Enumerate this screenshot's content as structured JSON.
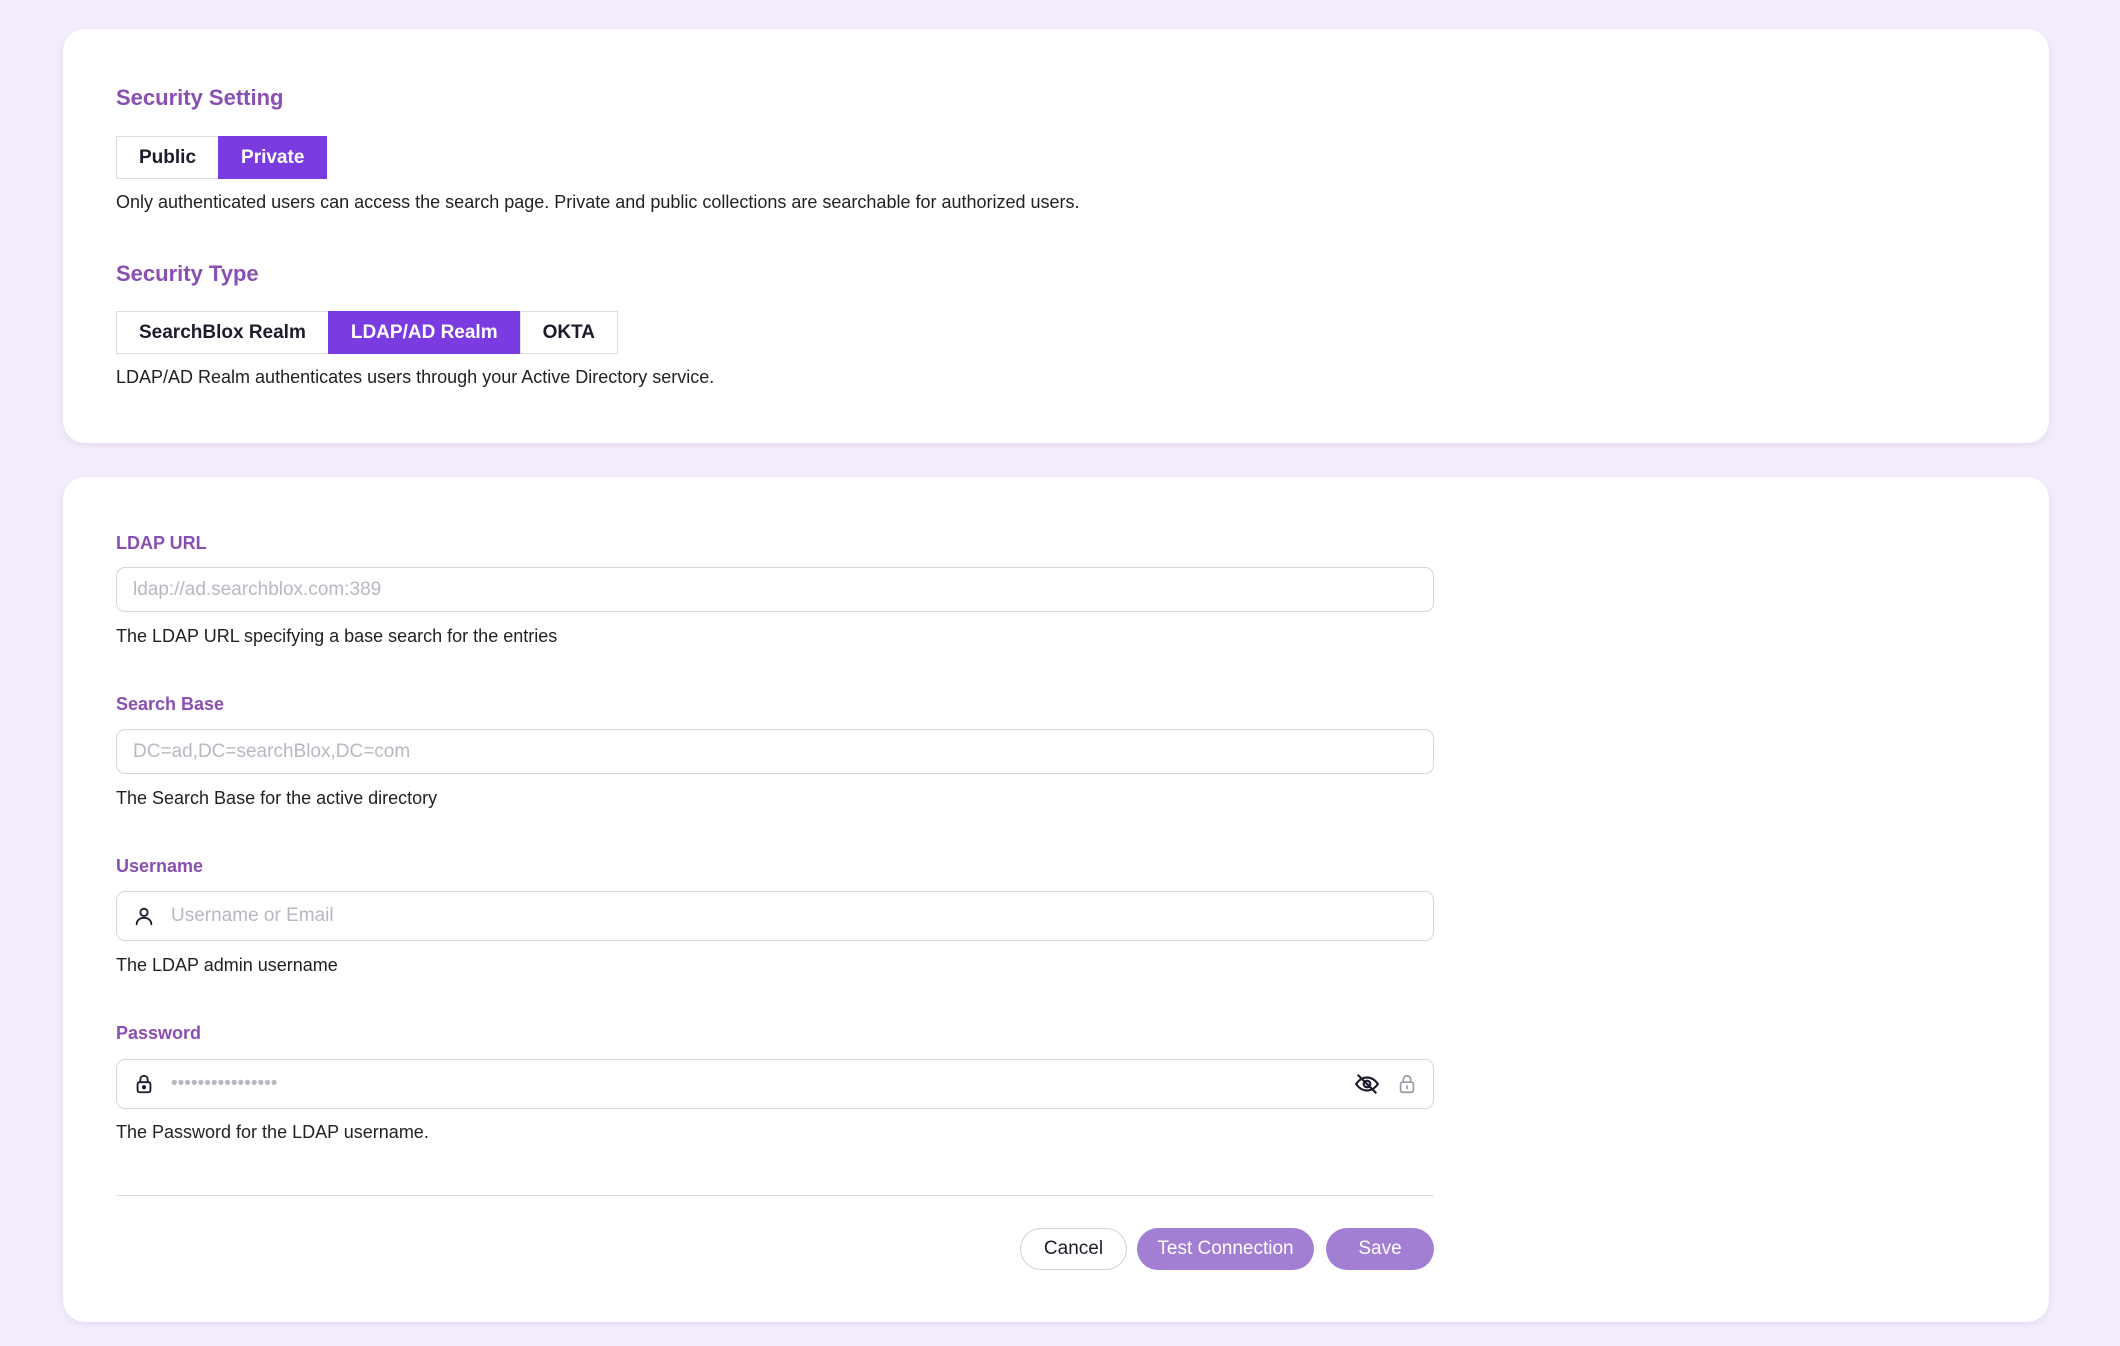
{
  "security_setting": {
    "title": "Security Setting",
    "options": [
      "Public",
      "Private"
    ],
    "selected": "Private",
    "description": "Only authenticated users can access the search page. Private and public collections are searchable for authorized users."
  },
  "security_type": {
    "title": "Security Type",
    "options": [
      "SearchBlox Realm",
      "LDAP/AD Realm",
      "OKTA"
    ],
    "selected": "LDAP/AD Realm",
    "description": "LDAP/AD Realm authenticates users through your Active Directory service."
  },
  "ldap": {
    "url": {
      "label": "LDAP URL",
      "placeholder": "ldap://ad.searchblox.com:389",
      "value": "",
      "help": "The LDAP URL specifying a base search for the entries"
    },
    "search_base": {
      "label": "Search Base",
      "placeholder": "DC=ad,DC=searchBlox,DC=com",
      "value": "",
      "help": "The Search Base for the active directory"
    },
    "username": {
      "label": "Username",
      "placeholder": "Username or Email",
      "value": "",
      "help": "The LDAP admin username",
      "icon": "user-icon"
    },
    "password": {
      "label": "Password",
      "placeholder": "••••••••••••••••",
      "value": "",
      "help": "The Password for the LDAP username.",
      "icon": "lock-icon",
      "toggle_icon": "eye-off-icon",
      "trailing_icon": "lock-icon"
    }
  },
  "actions": {
    "cancel": "Cancel",
    "test_connection": "Test Connection",
    "save": "Save"
  },
  "colors": {
    "accent": "#7a3be0",
    "label": "#8a4fb3",
    "button_muted": "#a27fd3",
    "background": "#f3ecfc"
  }
}
